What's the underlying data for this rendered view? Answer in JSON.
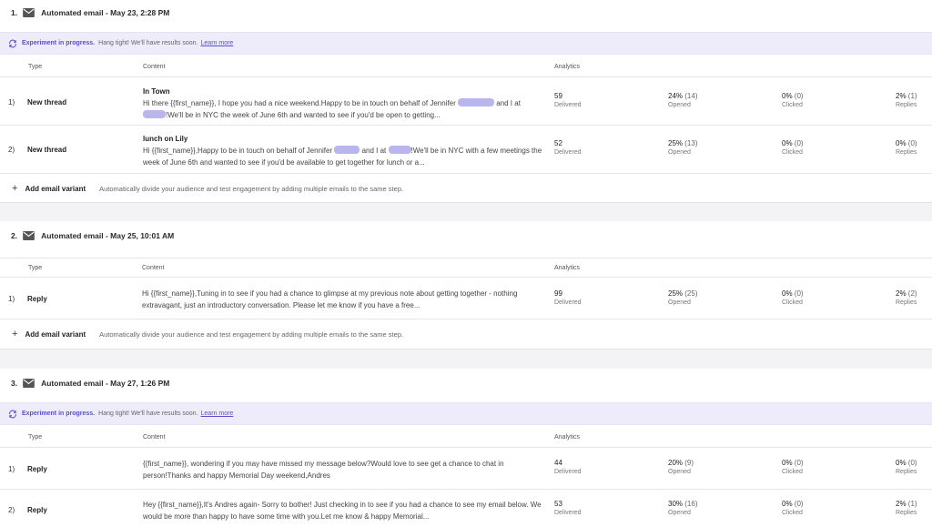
{
  "steps": [
    {
      "num": "1.",
      "title": "Automated email - May 23, 2:28 PM",
      "banner": {
        "bold": "Experiment in progress.",
        "text": "Hang tight! We'll have results soon.",
        "link": "Learn more"
      },
      "columns": {
        "type": "Type",
        "content": "Content",
        "analytics": "Analytics"
      },
      "rows": [
        {
          "idx": "1)",
          "type": "New thread",
          "subject": "In Town",
          "body_parts": [
            "Hi there {{first_name}}, I hope you had a nice weekend.Happy to be in touch on behalf of Jennifer ",
            " and I at ",
            "!We'll be in NYC the week of June 6th and wanted to see if you'd be open to getting..."
          ],
          "delivered": "59",
          "delivered_label": "Delivered",
          "opened": "24%",
          "opened_count": "(14)",
          "opened_label": "Opened",
          "clicked": "0%",
          "clicked_count": "(0)",
          "clicked_label": "Clicked",
          "replies": "2%",
          "replies_count": "(1)",
          "replies_label": "Replies"
        },
        {
          "idx": "2)",
          "type": "New thread",
          "subject": "lunch on Lily",
          "body_parts": [
            "Hi {{first_name}},Happy to be in touch on behalf of Jennifer ",
            " and I at ",
            "!We'll be in NYC with a few meetings the week of June 6th and wanted to see if you'd be available to get together for lunch or a..."
          ],
          "delivered": "52",
          "delivered_label": "Delivered",
          "opened": "25%",
          "opened_count": "(13)",
          "opened_label": "Opened",
          "clicked": "0%",
          "clicked_count": "(0)",
          "clicked_label": "Clicked",
          "replies": "0%",
          "replies_count": "(0)",
          "replies_label": "Replies"
        }
      ],
      "add_variant": {
        "label": "Add email variant",
        "hint": "Automatically divide your audience and test engagement by adding multiple emails to the same step."
      }
    },
    {
      "num": "2.",
      "title": "Automated email - May 25, 10:01 AM",
      "columns": {
        "type": "Type",
        "content": "Content",
        "analytics": "Analytics"
      },
      "rows": [
        {
          "idx": "1)",
          "type": "Reply",
          "body": "Hi {{first_name}},Tuning in to see if you had a chance to glimpse at my previous note about getting together - nothing extravagant, just an introductory conversation. Please let me know if you have a free...",
          "delivered": "99",
          "delivered_label": "Delivered",
          "opened": "25%",
          "opened_count": "(25)",
          "opened_label": "Opened",
          "clicked": "0%",
          "clicked_count": "(0)",
          "clicked_label": "Clicked",
          "replies": "2%",
          "replies_count": "(2)",
          "replies_label": "Replies"
        }
      ],
      "add_variant": {
        "label": "Add email variant",
        "hint": "Automatically divide your audience and test engagement by adding multiple emails to the same step."
      }
    },
    {
      "num": "3.",
      "title": "Automated email - May 27, 1:26 PM",
      "banner": {
        "bold": "Experiment in progress.",
        "text": "Hang tight! We'll have results soon.",
        "link": "Learn more"
      },
      "columns": {
        "type": "Type",
        "content": "Content",
        "analytics": "Analytics"
      },
      "rows": [
        {
          "idx": "1)",
          "type": "Reply",
          "body": "{{first_name}}, wondering if you may have missed my message below?Would love to see get a chance to chat in person!Thanks and happy Memorial Day weekend,Andres",
          "delivered": "44",
          "delivered_label": "Delivered",
          "opened": "20%",
          "opened_count": "(9)",
          "opened_label": "Opened",
          "clicked": "0%",
          "clicked_count": "(0)",
          "clicked_label": "Clicked",
          "replies": "0%",
          "replies_count": "(0)",
          "replies_label": "Replies"
        },
        {
          "idx": "2)",
          "type": "Reply",
          "body": "Hey {{first_name}},It's Andres again- Sorry to bother! Just checking in to see if you had a chance to see my email below. We would be more than happy to have some time with you.Let me know & happy Memorial...",
          "delivered": "53",
          "delivered_label": "Delivered",
          "opened": "30%",
          "opened_count": "(16)",
          "opened_label": "Opened",
          "clicked": "0%",
          "clicked_count": "(0)",
          "clicked_label": "Clicked",
          "replies": "2%",
          "replies_count": "(1)",
          "replies_label": "Replies"
        }
      ]
    }
  ],
  "colors": {
    "accent": "#5a4fcf",
    "banner_bg": "#eeecfb",
    "redaction": "#b9b6ee"
  },
  "icons": {
    "step": "envelope-icon",
    "banner": "sync-icon",
    "add": "plus-icon"
  }
}
